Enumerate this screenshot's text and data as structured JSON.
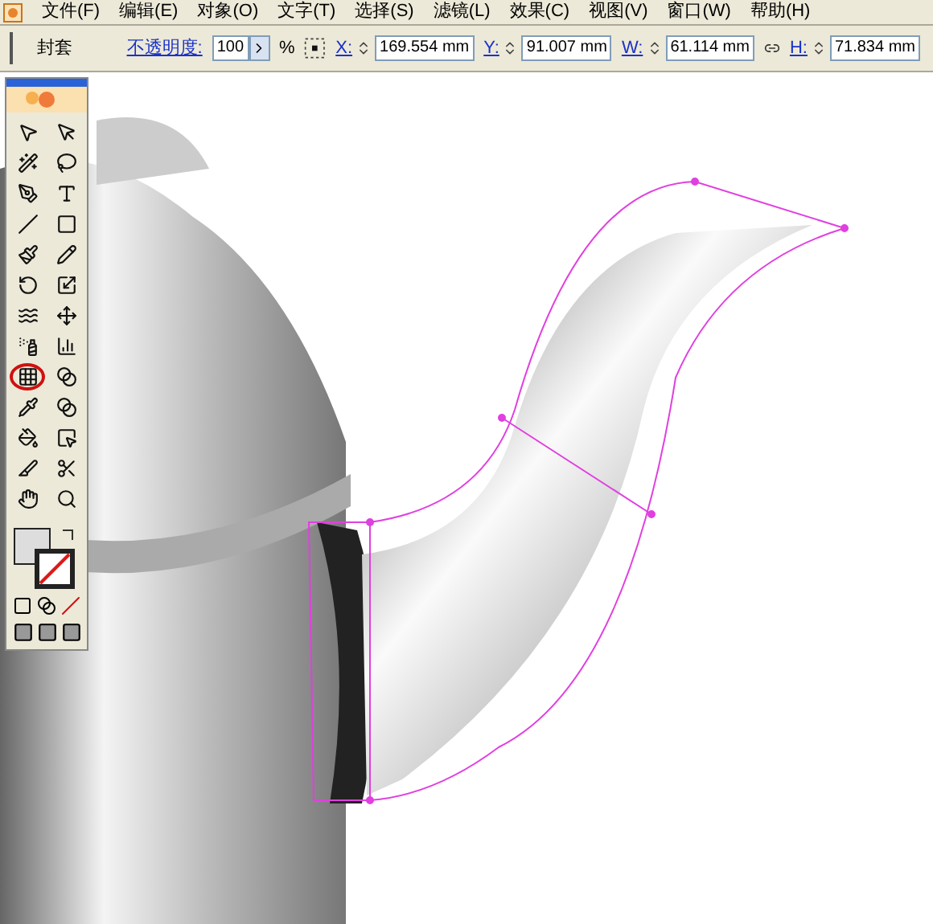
{
  "menu_bar": {
    "items": [
      {
        "label": "文件(F)"
      },
      {
        "label": "编辑(E)"
      },
      {
        "label": "对象(O)"
      },
      {
        "label": "文字(T)"
      },
      {
        "label": "选择(S)"
      },
      {
        "label": "滤镜(L)"
      },
      {
        "label": "效果(C)"
      },
      {
        "label": "视图(V)"
      },
      {
        "label": "窗口(W)"
      },
      {
        "label": "帮助(H)"
      }
    ]
  },
  "control_bar": {
    "tool_name": "封套",
    "opacity_label": "不透明度:",
    "opacity": "100",
    "percent": "%",
    "fields": [
      {
        "label": "X:",
        "value": "169.554 mm"
      },
      {
        "label": "Y:",
        "value": "91.007 mm"
      },
      {
        "label": "W:",
        "value": "61.114 mm"
      },
      {
        "label": "H:",
        "value": "71.834 mm"
      }
    ]
  },
  "toolbox": {
    "tools": [
      {
        "kind": "select",
        "circled": false
      },
      {
        "kind": "direct-select",
        "circled": false
      },
      {
        "kind": "magic-wand",
        "circled": false
      },
      {
        "kind": "lasso",
        "circled": false
      },
      {
        "kind": "pen",
        "circled": false
      },
      {
        "kind": "type",
        "circled": false
      },
      {
        "kind": "line",
        "circled": false
      },
      {
        "kind": "rectangle",
        "circled": false
      },
      {
        "kind": "brush",
        "circled": false
      },
      {
        "kind": "pencil",
        "circled": false
      },
      {
        "kind": "rotate",
        "circled": false
      },
      {
        "kind": "scale",
        "circled": false
      },
      {
        "kind": "warp",
        "circled": false
      },
      {
        "kind": "free-transform",
        "circled": false
      },
      {
        "kind": "sprayer",
        "circled": false
      },
      {
        "kind": "graph",
        "circled": false
      },
      {
        "kind": "mesh",
        "circled": true
      },
      {
        "kind": "gradient",
        "circled": false
      },
      {
        "kind": "eyedropper",
        "circled": false
      },
      {
        "kind": "blend",
        "circled": false
      },
      {
        "kind": "paint-bucket",
        "circled": false
      },
      {
        "kind": "paint-select",
        "circled": false
      },
      {
        "kind": "slice",
        "circled": false
      },
      {
        "kind": "scissors",
        "circled": false
      },
      {
        "kind": "hand",
        "circled": false
      },
      {
        "kind": "zoom",
        "circled": false
      }
    ]
  }
}
